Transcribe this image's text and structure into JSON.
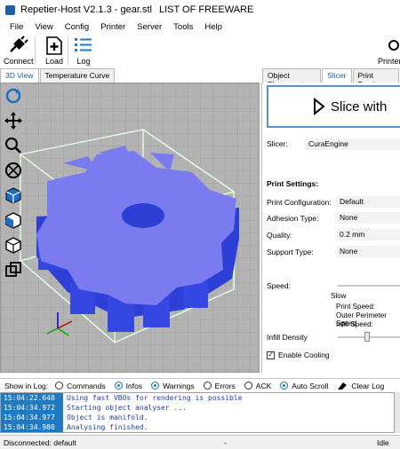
{
  "window": {
    "title": "Repetier-Host V2.1.3 - gear.stl",
    "subtitle": "LIST OF FREEWARE"
  },
  "menu": [
    "File",
    "View",
    "Config",
    "Printer",
    "Server",
    "Tools",
    "Help"
  ],
  "toolbar": {
    "connect": "Connect",
    "load": "Load",
    "log": "Log",
    "printer": "Printer"
  },
  "left_tabs": [
    "3D View",
    "Temperature Curve"
  ],
  "right_tabs": [
    "Object Placement",
    "Slicer",
    "Print Preview"
  ],
  "slicer": {
    "button": "Slice with",
    "slicer_label": "Slicer:",
    "slicer_value": "CuraEngine",
    "print_settings": "Print Settings:",
    "print_config_label": "Print Configuration:",
    "print_config_value": "Default",
    "adhesion_label": "Adhesion Type:",
    "adhesion_value": "None",
    "quality_label": "Quality:",
    "quality_value": "0.2 mm",
    "support_label": "Support Type:",
    "support_value": "None",
    "speed_label": "Speed:",
    "speed_slow": "Slow",
    "print_speed": "Print Speed:",
    "outer_perimeter": "Outer Perimeter Speed",
    "infill_speed": "Infill Speed:",
    "infill_density": "Infill Density",
    "enable_cooling": "Enable Cooling",
    "enable_cooling_checked": true
  },
  "log": {
    "show_label": "Show in Log:",
    "options": [
      "Commands",
      "Infos",
      "Warnings",
      "Errors",
      "ACK",
      "Auto Scroll"
    ],
    "options_checked": [
      false,
      true,
      true,
      false,
      false,
      true
    ],
    "clear": "Clear Log",
    "lines": [
      {
        "time": "15:04:22.648",
        "msg": "Using fast VBOs for rendering is possible"
      },
      {
        "time": "15:04:34.972",
        "msg": "Starting object analyser ..."
      },
      {
        "time": "15:04:34.977",
        "msg": "Object is manifold."
      },
      {
        "time": "15:04:34.980",
        "msg": "Analysing finished."
      }
    ]
  },
  "status": {
    "left": "Disconnected: default",
    "mid": "-",
    "right": "Idle"
  },
  "colors": {
    "gear": "#7b7bf0",
    "gear_dark": "#2e3fd6",
    "accent": "#1f7ac2",
    "box": "#dfffdf"
  }
}
